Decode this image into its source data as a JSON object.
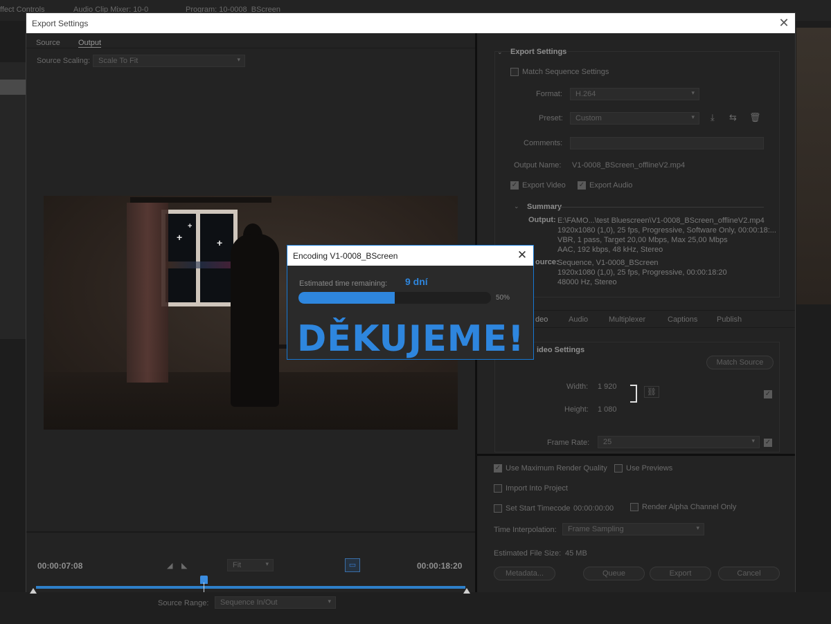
{
  "background": {
    "tabs": [
      "ffect Controls",
      "Audio Clip Mixer: 10-0",
      "Program: 10-0008_BScreen"
    ]
  },
  "window": {
    "title": "Export Settings",
    "close_glyph": "✕"
  },
  "left": {
    "tabs": [
      "Source",
      "Output"
    ],
    "active_tab": "Output",
    "scaling_label": "Source Scaling:",
    "scaling_value": "Scale To Fit",
    "timecode_start": "00:00:07:08",
    "timecode_end": "00:00:18:20",
    "fit_value": "Fit",
    "range_label": "Source Range:",
    "range_value": "Sequence In/Out",
    "playhead_fraction": 0.39
  },
  "export_settings": {
    "title": "Export Settings",
    "match_sequence": "Match Sequence Settings",
    "format_label": "Format:",
    "format_value": "H.264",
    "preset_label": "Preset:",
    "preset_value": "Custom",
    "comments_label": "Comments:",
    "output_name_label": "Output Name:",
    "output_name_value": "V1-0008_BScreen_offlineV2.mp4",
    "export_video": "Export Video",
    "export_audio": "Export Audio",
    "summary_title": "Summary",
    "output_label": "Output:",
    "output_lines": [
      "E:\\FAMO...\\test Bluescreen\\V1-0008_BScreen_offlineV2.mp4",
      "1920x1080 (1,0), 25 fps, Progressive, Software Only, 00:00:18:...",
      "VBR, 1 pass, Target 20,00 Mbps, Max 25,00 Mbps",
      "AAC, 192 kbps, 48 kHz, Stereo"
    ],
    "source_label": "ource:",
    "source_lines": [
      "Sequence, V1-0008_BScreen",
      "1920x1080 (1,0), 25 fps, Progressive, 00:00:18:20",
      "48000 Hz, Stereo"
    ]
  },
  "tabs2": [
    "deo",
    "Audio",
    "Multiplexer",
    "Captions",
    "Publish"
  ],
  "video_settings": {
    "title": "ideo Settings",
    "match_source": "Match Source",
    "width_label": "Width:",
    "width_value": "1 920",
    "height_label": "Height:",
    "height_value": "1 080",
    "frame_rate_label": "Frame Rate:",
    "frame_rate_value": "25"
  },
  "bottom": {
    "max_quality": "Use Maximum Render Quality",
    "use_previews": "Use Previews",
    "import_project": "Import Into Project",
    "start_timecode": "Set Start Timecode",
    "start_timecode_value": "00:00:00:00",
    "alpha_only": "Render Alpha Channel Only",
    "time_interp_label": "Time Interpolation:",
    "time_interp_value": "Frame Sampling",
    "file_size_label": "Estimated File Size:",
    "file_size_value": "45 MB",
    "metadata_btn": "Metadata...",
    "queue_btn": "Queue",
    "export_btn": "Export",
    "cancel_btn": "Cancel"
  },
  "dialog": {
    "title": "Encoding V1-0008_BScreen",
    "close_glyph": "✕",
    "estimated_label": "Estimated time remaining:",
    "estimated_value": "9 dní",
    "progress_percent": 50,
    "progress_label": "50%",
    "overlay_text": "DĚKUJEME!",
    "accent_color": "#2e86de"
  }
}
